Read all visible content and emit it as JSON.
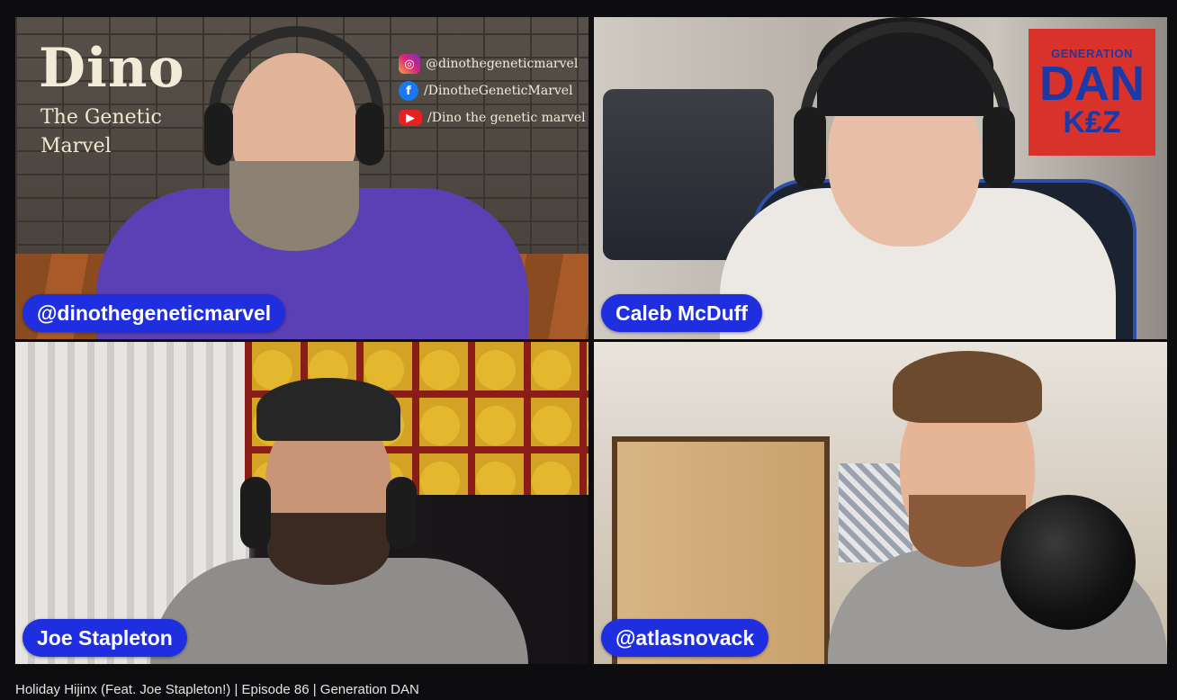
{
  "tiles": [
    {
      "name": "@dinothegeneticmarvel",
      "overlay": {
        "title": "Dino",
        "subtitle": "The Genetic Marvel",
        "socials": [
          {
            "icon": "instagram-icon",
            "glyph": "◎",
            "text": "@dinothegeneticmarvel"
          },
          {
            "icon": "facebook-icon",
            "glyph": "f",
            "text": "/DinotheGeneticMarvel"
          },
          {
            "icon": "youtube-icon",
            "glyph": "▶",
            "text": "/Dino the genetic marvel"
          }
        ]
      }
    },
    {
      "name": "Caleb McDuff",
      "badge": {
        "line1": "GENERATION",
        "line2": "DAN",
        "line3": "K₤Z"
      }
    },
    {
      "name": "Joe Stapleton"
    },
    {
      "name": "@atlasnovack"
    }
  ],
  "ticker": "Holiday Hijinx (Feat. Joe Stapleton!) | Episode 86 | Generation DAN",
  "colors": {
    "name_tag_bg": "#1f2fe0",
    "badge_bg": "#d8322a",
    "badge_text": "#1b3aa8"
  }
}
